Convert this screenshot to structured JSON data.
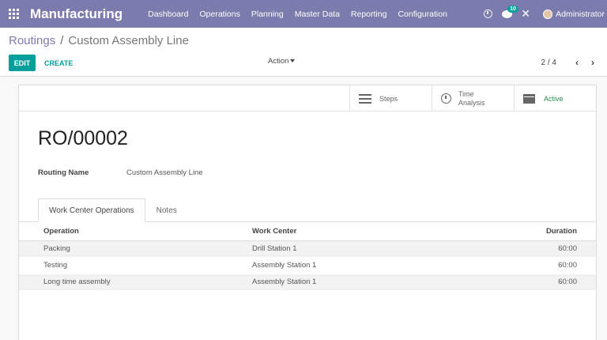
{
  "navbar": {
    "app_name": "Manufacturing",
    "menu": [
      "Dashboard",
      "Operations",
      "Planning",
      "Master Data",
      "Reporting",
      "Configuration"
    ],
    "chat_badge": "10",
    "user_name": "Administrator",
    "bg_color": "#7c7bad"
  },
  "breadcrumb": {
    "parent": "Routings",
    "separator": "/",
    "current": "Custom Assembly Line"
  },
  "buttons": {
    "edit": "EDIT",
    "create": "CREATE",
    "action": "Action"
  },
  "pager": {
    "value": "2 / 4",
    "prev": "‹",
    "next": "›"
  },
  "smart_buttons": {
    "steps": "Steps",
    "time_analysis_line1": "Time",
    "time_analysis_line2": "Analysis",
    "active": "Active"
  },
  "record": {
    "title": "RO/00002",
    "routing_name_label": "Routing Name",
    "routing_name_value": "Custom Assembly Line"
  },
  "tabs": [
    "Work Center Operations",
    "Notes"
  ],
  "table": {
    "headers": [
      "Operation",
      "Work Center",
      "Duration"
    ],
    "rows": [
      [
        "Packing",
        "Drill Station 1",
        "60:00"
      ],
      [
        "Testing",
        "Assembly Station 1",
        "60:00"
      ],
      [
        "Long time assembly",
        "Assembly Station 1",
        "60:00"
      ]
    ]
  },
  "icons": {
    "apps": "apps-grid-icon",
    "activity": "clock-icon",
    "chat": "chat-icon",
    "debug": "close-icon",
    "steps": "list-icon",
    "time": "clock-icon",
    "archive": "archive-icon"
  },
  "colors": {
    "accent": "#00a09d",
    "active_green": "#2e8b57"
  }
}
